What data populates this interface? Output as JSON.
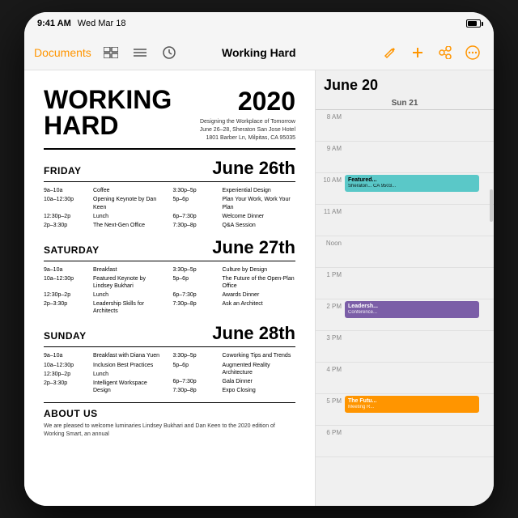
{
  "device": {
    "status_bar": {
      "time": "9:41 AM",
      "date": "Wed Mar 18"
    }
  },
  "toolbar": {
    "documents_label": "Documents",
    "title": "Working Hard",
    "icons": [
      "⊡",
      "☰",
      "🕐",
      "✏",
      "+",
      "👤",
      "⊙"
    ]
  },
  "document": {
    "title_line1": "WORKING",
    "title_line2": "HARD",
    "year": "2020",
    "subtitle_line1": "Designing the Workplace of Tomorrow",
    "subtitle_line2": "June 26–28, Sheraton San Jose Hotel",
    "subtitle_line3": "1801 Barber Ln, Milpitas, CA 95035",
    "days": [
      {
        "name": "FRIDAY",
        "date": "June 26th",
        "schedule_left": [
          {
            "time": "9a–10a",
            "event": "Coffee"
          },
          {
            "time": "10a–12:30p",
            "event": "Opening Keynote\nby Dan Keen"
          },
          {
            "time": "12:30p–2p",
            "event": "Lunch"
          },
          {
            "time": "2p–3:30p",
            "event": "The Next-Gen Office"
          }
        ],
        "schedule_right": [
          {
            "time": "3:30p–5p",
            "event": "Experiential Design"
          },
          {
            "time": "5p–6p",
            "event": "Plan Your Work,\nWork Your Plan"
          },
          {
            "time": "6p–7:30p",
            "event": "Welcome Dinner"
          },
          {
            "time": "7:30p–8p",
            "event": "Q&A Session"
          }
        ]
      },
      {
        "name": "SATURDAY",
        "date": "June 27th",
        "schedule_left": [
          {
            "time": "9a–10a",
            "event": "Breakfast"
          },
          {
            "time": "10a–12:30p",
            "event": "Featured Keynote\nby Lindsey Bukhari"
          },
          {
            "time": "12:30p–2p",
            "event": "Lunch"
          },
          {
            "time": "2p–3:30p",
            "event": "Leadership Skills\nfor Architects"
          }
        ],
        "schedule_right": [
          {
            "time": "3:30p–5p",
            "event": "Culture by Design"
          },
          {
            "time": "5p–6p",
            "event": "The Future of the\nOpen-Plan Office"
          },
          {
            "time": "6p–7:30p",
            "event": "Awards Dinner"
          },
          {
            "time": "7:30p–8p",
            "event": "Ask an Architect"
          }
        ]
      },
      {
        "name": "SUNDAY",
        "date": "June 28th",
        "schedule_left": [
          {
            "time": "9a–10a",
            "event": "Breakfast with\nDiana Yuen"
          },
          {
            "time": "10a–12:30p",
            "event": "Inclusion Best\nPractices"
          },
          {
            "time": "12:30p–2p",
            "event": "Lunch"
          },
          {
            "time": "2p–3:30p",
            "event": "Intelligent Workspace\nDesign"
          }
        ],
        "schedule_right": [
          {
            "time": "3:30p–5p",
            "event": "Coworking Tips\nand Trends"
          },
          {
            "time": "5p–6p",
            "event": "Augmented Reality\nArchitecture"
          },
          {
            "time": "6p–7:30p",
            "event": "Gala Dinner"
          },
          {
            "time": "7:30p–8p",
            "event": "Expo Closing"
          }
        ]
      }
    ],
    "about": {
      "header": "ABOUT US",
      "text": "We are pleased to welcome luminaries Lindsey Bukhari and Dan Keen to the 2020 edition of Working Smart, an annual"
    }
  },
  "calendar": {
    "header": "June 20",
    "day_label": "Sun 21",
    "hours": [
      {
        "label": "8 AM",
        "events": []
      },
      {
        "label": "9 AM",
        "events": []
      },
      {
        "label": "10 AM",
        "events": [
          {
            "title": "Featured...",
            "detail": "Sheraton...\nCA 9503...",
            "color": "teal"
          }
        ]
      },
      {
        "label": "11 AM",
        "events": []
      },
      {
        "label": "Noon",
        "events": []
      },
      {
        "label": "1 PM",
        "events": []
      },
      {
        "label": "2 PM",
        "events": [
          {
            "title": "Leadersh...",
            "detail": "Conference...",
            "color": "purple"
          }
        ]
      },
      {
        "label": "3 PM",
        "events": []
      },
      {
        "label": "4 PM",
        "events": []
      },
      {
        "label": "5 PM",
        "events": [
          {
            "title": "The Futu...",
            "detail": "Meeting R...",
            "color": "orange"
          }
        ]
      },
      {
        "label": "6 PM",
        "events": []
      }
    ]
  }
}
